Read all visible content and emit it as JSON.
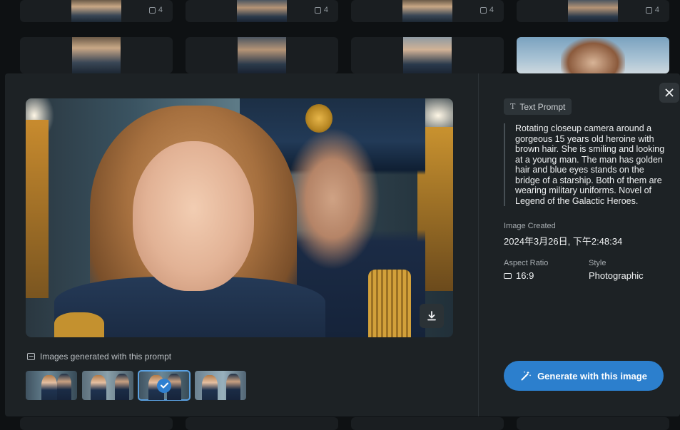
{
  "gallery": {
    "top_counts": [
      "4",
      "4",
      "4",
      "4"
    ]
  },
  "modal": {
    "close_label": "×",
    "gen_label": "Images generated with this prompt",
    "thumbnails": [
      {
        "selected": false
      },
      {
        "selected": false
      },
      {
        "selected": true
      },
      {
        "selected": false
      }
    ],
    "details": {
      "prompt_tag": "Text Prompt",
      "prompt_tag_icon": "T",
      "prompt": "Rotating closeup camera around a gorgeous 15 years old heroine with brown hair. She is smiling and looking at a young man. The man has golden hair and blue eyes stands on the bridge of a starship. Both of them are wearing military uniforms. Novel of Legend of the Galactic Heroes.",
      "created_label": "Image Created",
      "created_value": "2024年3月26日, 下午2:48:34",
      "aspect_label": "Aspect Ratio",
      "aspect_value": "16:9",
      "style_label": "Style",
      "style_value": "Photographic",
      "generate_label": "Generate with this image"
    },
    "colors": {
      "accent": "#2c7fcd",
      "panel": "#1d2225",
      "selected_outline": "#5aa0e0"
    }
  }
}
